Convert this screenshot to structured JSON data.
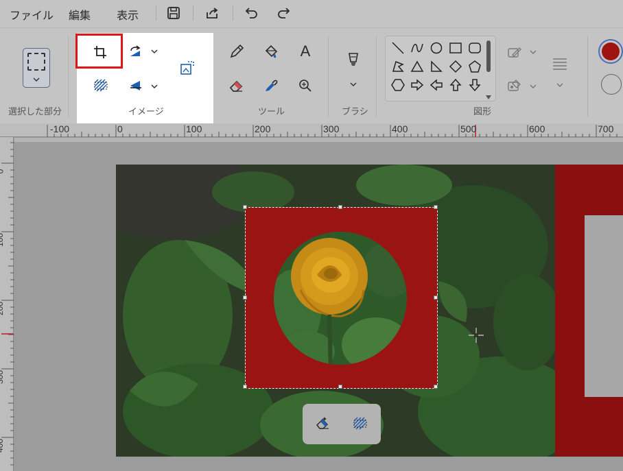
{
  "menu": {
    "file": "ファイル",
    "edit": "編集",
    "view": "表示"
  },
  "quick_access": {
    "icons": [
      "save-icon",
      "share-icon",
      "undo-icon",
      "redo-icon"
    ]
  },
  "ribbon": {
    "groups": {
      "selection": "選択した部分",
      "image": "イメージ",
      "tools": "ツール",
      "brush": "ブラシ",
      "shapes": "図形"
    },
    "image_tools": [
      "crop-icon",
      "rotate-icon",
      "resize-icon",
      "select-all-icon",
      "flip-icon"
    ],
    "tools": [
      "pencil-icon",
      "fill-icon",
      "text-icon",
      "eraser-icon",
      "color-picker-icon",
      "magnifier-icon"
    ],
    "shapes": [
      "line",
      "curve",
      "oval",
      "rectangle",
      "rounded-rectangle",
      "polygon",
      "triangle",
      "right-triangle",
      "diamond",
      "pentagon",
      "hexagon",
      "right-arrow",
      "left-arrow",
      "up-arrow",
      "down-arrow"
    ],
    "text_tool_glyph": "A",
    "highlighted_tool": "crop"
  },
  "colors": {
    "primary": "#a01313",
    "secondary": "#ffffff",
    "highlight": "#e01515",
    "selection_fill": "#9b1414"
  },
  "ruler": {
    "top_labels": [
      "-100",
      "0",
      "100",
      "200",
      "300",
      "400",
      "500",
      "600",
      "700"
    ],
    "left_labels": [
      "0",
      "100",
      "200",
      "300",
      "400"
    ]
  },
  "floating_toolbar": {
    "icons": [
      "erase-selection-icon",
      "remove-background-icon"
    ]
  }
}
